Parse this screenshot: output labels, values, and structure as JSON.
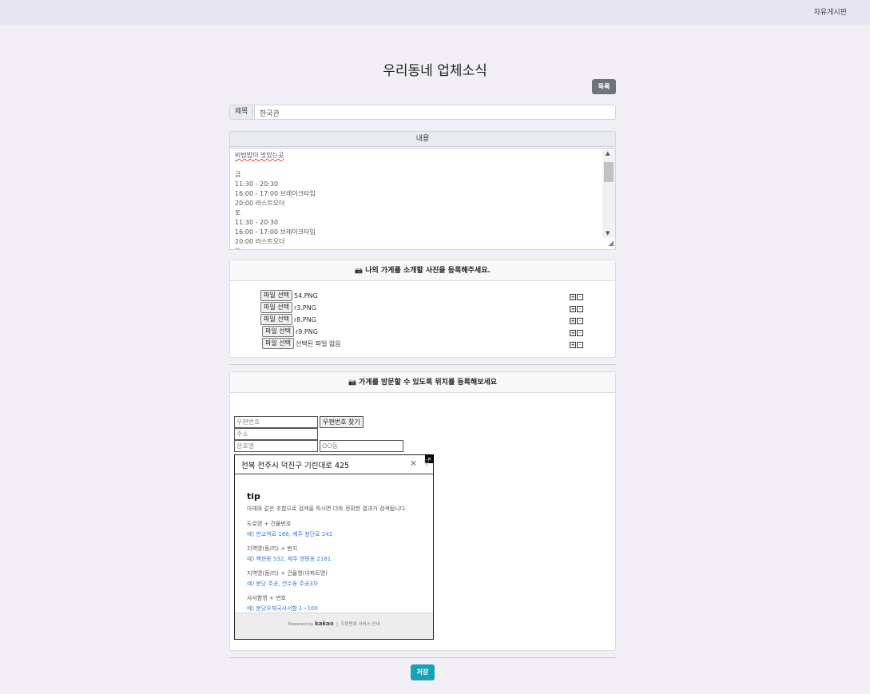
{
  "topbar": {
    "nav_link": "자유게시판"
  },
  "page": {
    "title": "우리동네 업체소식",
    "list_button": "목록"
  },
  "title_field": {
    "prefix": "제목",
    "value": "한국관"
  },
  "content": {
    "header": "내용",
    "lines": [
      "비빔밥이 맛있는곳",
      "",
      "금",
      "11:30 - 20:30",
      "16:00 - 17:00 브레이크타임",
      "20:00 라스트오더",
      "토",
      "11:30 - 20:30",
      "16:00 - 17:00 브레이크타임",
      "20:00 라스트오더",
      "일"
    ]
  },
  "photos": {
    "header": "나의 가게를 소개할 사진을 등록해주세요.",
    "file_button_label": "파일 선택",
    "files": [
      "54.PNG",
      "r3.PNG",
      "r8.PNG",
      "r9.PNG",
      "선택된 파일 없음"
    ],
    "plus": "+",
    "minus": "-"
  },
  "location": {
    "header": "가게를 방문할 수 있도록 위치를 등록해보세요",
    "postcode_placeholder": "우편번호",
    "find_button": "우편번호 찾기",
    "address_placeholder": "주소",
    "shop_placeholder": "상호명",
    "dong_placeholder": "OO동"
  },
  "postcode_popup": {
    "close": "×",
    "query": "전북 전주시 덕진구 기린대로 425",
    "clear": "✕",
    "search": "⚲",
    "tip_title": "tip",
    "tip_desc": "아래와 같은 조합으로 검색을 하시면 더욱 정확한 결과가 검색됩니다.",
    "examples": [
      {
        "label": "도로명 + 건물번호",
        "value": "예) 판교역로 166, 제주 첨단로 242"
      },
      {
        "label": "지역명(동/리) + 번지",
        "value": "예) 백현동 532, 제주 영평동 2181"
      },
      {
        "label": "지역명(동/리) + 건물명(아파트명)",
        "value": "예) 분당 주공, 연수동 주공3차"
      },
      {
        "label": "사서함명 + 번호",
        "value": "예) 분당우체국사서함 1~100"
      }
    ],
    "footer_powered": "Powered by",
    "footer_brand": "kakao",
    "footer_link": "우편번호 서비스 안내"
  },
  "save_button": "저장"
}
